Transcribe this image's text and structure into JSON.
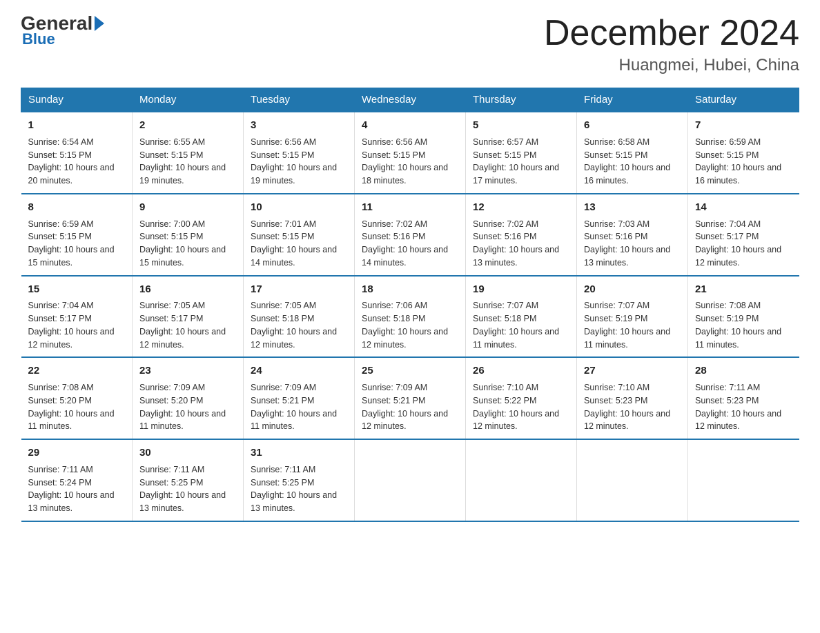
{
  "logo": {
    "general": "General",
    "arrow": "▶",
    "blue": "Blue"
  },
  "title": "December 2024",
  "subtitle": "Huangmei, Hubei, China",
  "days_of_week": [
    "Sunday",
    "Monday",
    "Tuesday",
    "Wednesday",
    "Thursday",
    "Friday",
    "Saturday"
  ],
  "weeks": [
    [
      {
        "num": "1",
        "sunrise": "6:54 AM",
        "sunset": "5:15 PM",
        "daylight": "10 hours and 20 minutes."
      },
      {
        "num": "2",
        "sunrise": "6:55 AM",
        "sunset": "5:15 PM",
        "daylight": "10 hours and 19 minutes."
      },
      {
        "num": "3",
        "sunrise": "6:56 AM",
        "sunset": "5:15 PM",
        "daylight": "10 hours and 19 minutes."
      },
      {
        "num": "4",
        "sunrise": "6:56 AM",
        "sunset": "5:15 PM",
        "daylight": "10 hours and 18 minutes."
      },
      {
        "num": "5",
        "sunrise": "6:57 AM",
        "sunset": "5:15 PM",
        "daylight": "10 hours and 17 minutes."
      },
      {
        "num": "6",
        "sunrise": "6:58 AM",
        "sunset": "5:15 PM",
        "daylight": "10 hours and 16 minutes."
      },
      {
        "num": "7",
        "sunrise": "6:59 AM",
        "sunset": "5:15 PM",
        "daylight": "10 hours and 16 minutes."
      }
    ],
    [
      {
        "num": "8",
        "sunrise": "6:59 AM",
        "sunset": "5:15 PM",
        "daylight": "10 hours and 15 minutes."
      },
      {
        "num": "9",
        "sunrise": "7:00 AM",
        "sunset": "5:15 PM",
        "daylight": "10 hours and 15 minutes."
      },
      {
        "num": "10",
        "sunrise": "7:01 AM",
        "sunset": "5:15 PM",
        "daylight": "10 hours and 14 minutes."
      },
      {
        "num": "11",
        "sunrise": "7:02 AM",
        "sunset": "5:16 PM",
        "daylight": "10 hours and 14 minutes."
      },
      {
        "num": "12",
        "sunrise": "7:02 AM",
        "sunset": "5:16 PM",
        "daylight": "10 hours and 13 minutes."
      },
      {
        "num": "13",
        "sunrise": "7:03 AM",
        "sunset": "5:16 PM",
        "daylight": "10 hours and 13 minutes."
      },
      {
        "num": "14",
        "sunrise": "7:04 AM",
        "sunset": "5:17 PM",
        "daylight": "10 hours and 12 minutes."
      }
    ],
    [
      {
        "num": "15",
        "sunrise": "7:04 AM",
        "sunset": "5:17 PM",
        "daylight": "10 hours and 12 minutes."
      },
      {
        "num": "16",
        "sunrise": "7:05 AM",
        "sunset": "5:17 PM",
        "daylight": "10 hours and 12 minutes."
      },
      {
        "num": "17",
        "sunrise": "7:05 AM",
        "sunset": "5:18 PM",
        "daylight": "10 hours and 12 minutes."
      },
      {
        "num": "18",
        "sunrise": "7:06 AM",
        "sunset": "5:18 PM",
        "daylight": "10 hours and 12 minutes."
      },
      {
        "num": "19",
        "sunrise": "7:07 AM",
        "sunset": "5:18 PM",
        "daylight": "10 hours and 11 minutes."
      },
      {
        "num": "20",
        "sunrise": "7:07 AM",
        "sunset": "5:19 PM",
        "daylight": "10 hours and 11 minutes."
      },
      {
        "num": "21",
        "sunrise": "7:08 AM",
        "sunset": "5:19 PM",
        "daylight": "10 hours and 11 minutes."
      }
    ],
    [
      {
        "num": "22",
        "sunrise": "7:08 AM",
        "sunset": "5:20 PM",
        "daylight": "10 hours and 11 minutes."
      },
      {
        "num": "23",
        "sunrise": "7:09 AM",
        "sunset": "5:20 PM",
        "daylight": "10 hours and 11 minutes."
      },
      {
        "num": "24",
        "sunrise": "7:09 AM",
        "sunset": "5:21 PM",
        "daylight": "10 hours and 11 minutes."
      },
      {
        "num": "25",
        "sunrise": "7:09 AM",
        "sunset": "5:21 PM",
        "daylight": "10 hours and 12 minutes."
      },
      {
        "num": "26",
        "sunrise": "7:10 AM",
        "sunset": "5:22 PM",
        "daylight": "10 hours and 12 minutes."
      },
      {
        "num": "27",
        "sunrise": "7:10 AM",
        "sunset": "5:23 PM",
        "daylight": "10 hours and 12 minutes."
      },
      {
        "num": "28",
        "sunrise": "7:11 AM",
        "sunset": "5:23 PM",
        "daylight": "10 hours and 12 minutes."
      }
    ],
    [
      {
        "num": "29",
        "sunrise": "7:11 AM",
        "sunset": "5:24 PM",
        "daylight": "10 hours and 13 minutes."
      },
      {
        "num": "30",
        "sunrise": "7:11 AM",
        "sunset": "5:25 PM",
        "daylight": "10 hours and 13 minutes."
      },
      {
        "num": "31",
        "sunrise": "7:11 AM",
        "sunset": "5:25 PM",
        "daylight": "10 hours and 13 minutes."
      },
      null,
      null,
      null,
      null
    ]
  ]
}
